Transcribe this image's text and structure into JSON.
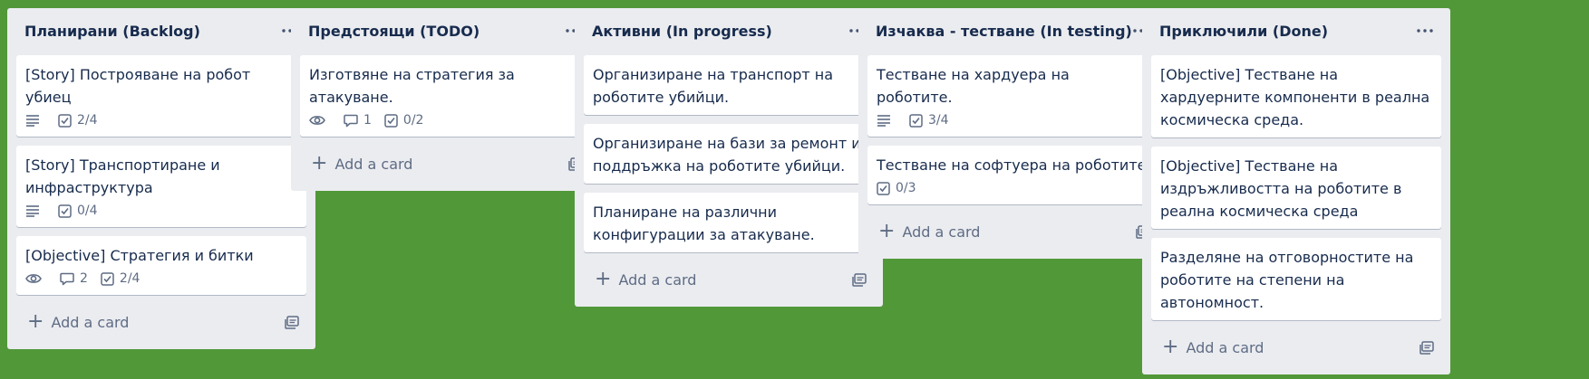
{
  "lists": [
    {
      "title": "Планирани (Backlog)",
      "cards": [
        {
          "title": "[Story] Построяване на робот убиец",
          "description": true,
          "checklist": "2/4"
        },
        {
          "title": "[Story] Транспортиране и инфраструктура",
          "description": true,
          "checklist": "0/4"
        },
        {
          "title": "[Objective] Стратегия и битки",
          "watch": true,
          "comments": "2",
          "checklist": "2/4"
        }
      ],
      "add_label": "Add a card"
    },
    {
      "title": "Предстоящи (TODO)",
      "cards": [
        {
          "title": "Изготвяне на стратегия за атакуване.",
          "watch": true,
          "comments": "1",
          "checklist": "0/2"
        }
      ],
      "add_label": "Add a card"
    },
    {
      "title": "Активни (In progress)",
      "cards": [
        {
          "title": "Организиране на транспорт на роботите убийци."
        },
        {
          "title": "Организиране на бази за ремонт и поддръжка на роботите убийци."
        },
        {
          "title": "Планиране на различни конфигурации за атакуване."
        }
      ],
      "add_label": "Add a card"
    },
    {
      "title": "Изчаква - тестване (In testing)",
      "cards": [
        {
          "title": "Тестване на хардуера на роботите.",
          "description": true,
          "checklist": "3/4"
        },
        {
          "title": "Тестване на софтуера на роботите",
          "checklist": "0/3"
        }
      ],
      "add_label": "Add a card"
    },
    {
      "title": "Приключили (Done)",
      "cards": [
        {
          "title": "[Objective] Тестване на хардуерните компоненти в реална космическа среда."
        },
        {
          "title": "[Objective] Тестване на издръжливостта на роботите в реална космическа среда"
        },
        {
          "title": "Разделяне на отговорностите на роботите на степени на автономност."
        }
      ],
      "add_label": "Add a card"
    }
  ],
  "icons": {
    "description": "description-icon",
    "watch": "eye-icon",
    "comments": "comment-icon",
    "checklist": "checklist-icon",
    "menu": "more-horizontal-icon",
    "template": "card-template-icon"
  },
  "colors": {
    "board_background": "#519839",
    "list_background": "#ebecf0",
    "card_background": "#ffffff",
    "text": "#172b4d",
    "muted": "#5e6c84"
  }
}
